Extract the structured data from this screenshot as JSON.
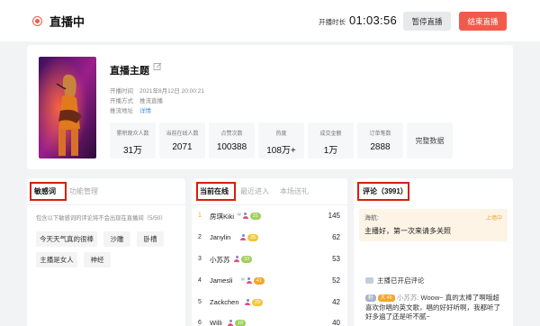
{
  "header": {
    "status": "直播中",
    "duration_label": "开播时长",
    "duration": "01:03:56",
    "pause_button": "暂停直播",
    "end_button": "结束直播"
  },
  "stream": {
    "title": "直播主题",
    "start_time_label": "开播时间",
    "start_time": "2021年8月12日 20:00:21",
    "method_label": "开播方式",
    "method": "推流直播",
    "address_label": "推流地址",
    "address_link": "详情"
  },
  "stats": [
    {
      "label": "累积观众人数",
      "value": "31万"
    },
    {
      "label": "当前在线人数",
      "value": "2071"
    },
    {
      "label": "点赞次数",
      "value": "100388"
    },
    {
      "label": "热度",
      "value": "108万+"
    },
    {
      "label": "成交金额",
      "value": "1万"
    },
    {
      "label": "订单笔数",
      "value": "2888"
    }
  ],
  "full_data_button": "完整数据",
  "sensitive_panel": {
    "tabs": [
      "敏感词",
      "功能管理"
    ],
    "hint": "包含以下敏感词的评论将不会出现在直播间（5/50）",
    "words": [
      "今天天气真的很棒",
      "沙雕",
      "卧槽",
      "主播是女人",
      "神经"
    ]
  },
  "viewers_panel": {
    "tabs": [
      "当前在线",
      "最近进入",
      "本场送礼"
    ],
    "viewers": [
      {
        "rank": "1",
        "name": "房琪Kiki",
        "level": "31",
        "score": "145"
      },
      {
        "rank": "2",
        "name": "Janylin",
        "level": "26",
        "score": "62"
      },
      {
        "rank": "3",
        "name": "小苏苏",
        "level": "33",
        "score": "53"
      },
      {
        "rank": "4",
        "name": "Jamesli",
        "level": "41",
        "score": "52"
      },
      {
        "rank": "5",
        "name": "Zackchen",
        "level": "29",
        "score": "42"
      },
      {
        "rank": "6",
        "name": "Willi",
        "level": "18",
        "score": "40"
      }
    ]
  },
  "comments_panel": {
    "title": "评论（3991）",
    "pinned": {
      "author": "海航:",
      "badge": "上墙中",
      "text": "主播好，第一次来请多关照"
    },
    "system_message": "主播已开启评论",
    "comment": {
      "tag1": "粉",
      "tag2": "大 45",
      "user": "小苏苏:",
      "text": "Woow~ 真的太棒了啊哦超喜欢你唱的英文歌，唱的好好听啊，我都听了好多遍了还是听不腻~"
    }
  },
  "colors": {
    "accent_red": "#f25a4c",
    "highlight_box": "#d81e06",
    "link_blue": "#4a90e2"
  }
}
